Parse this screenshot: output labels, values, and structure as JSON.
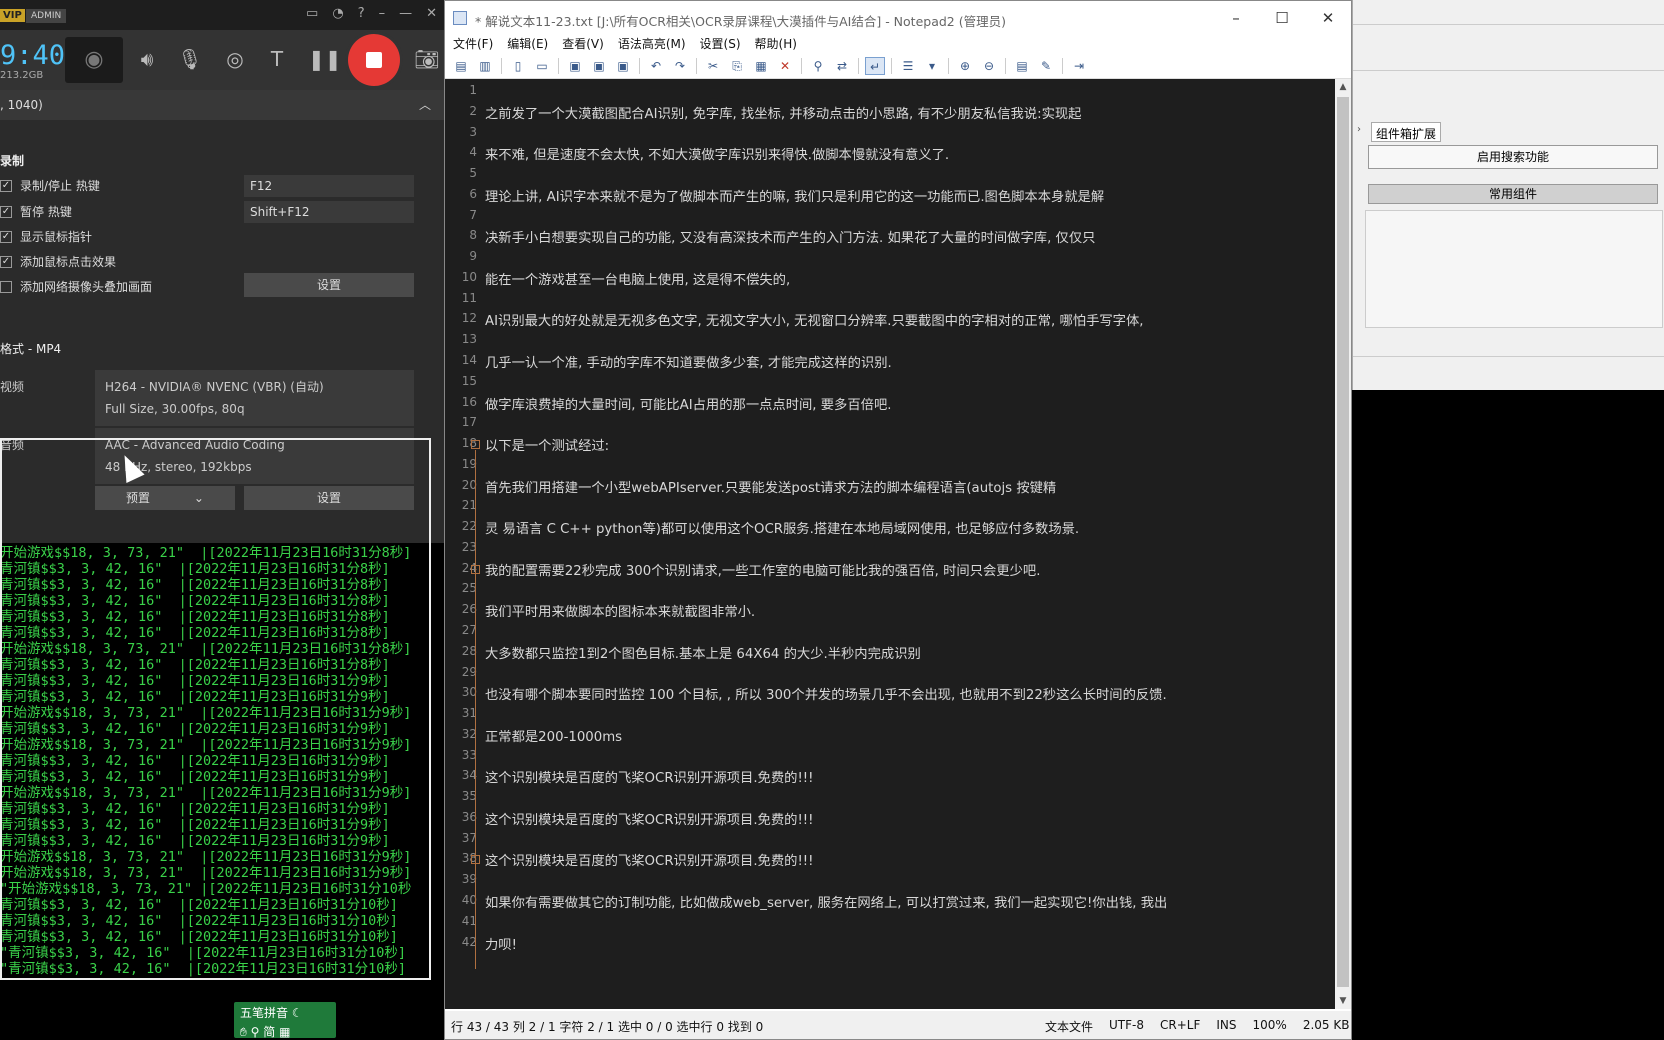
{
  "recorder": {
    "vip": "VIP",
    "admin": "ADMIN",
    "timer": "9:40",
    "storage": "213.2GB",
    "section_header": ", 1040)",
    "record_title": "录制",
    "checkboxes": [
      {
        "label": "录制/停止 热键",
        "checked": true,
        "value": "F12"
      },
      {
        "label": "暂停 热键",
        "checked": true,
        "value": "Shift+F12"
      },
      {
        "label": "显示鼠标指针",
        "checked": true
      },
      {
        "label": "添加鼠标点击效果",
        "checked": true
      },
      {
        "label": "添加网络摄像头叠加画面",
        "checked": false
      }
    ],
    "settings_button": "设置",
    "format_title": "格式 - MP4",
    "video_label": "视频",
    "video_line1": "H264 - NVIDIA® NVENC (VBR) (自动)",
    "video_line2": "Full Size, 30.00fps, 80q",
    "audio_label": "音频",
    "audio_line1": "AAC - Advanced Audio Coding",
    "audio_line2": "48 KHz, stereo, 192kbps",
    "preset_button": "预置",
    "settings_button2": "设置"
  },
  "console_lines": [
    "开始游戏$$18, 3, 73, 21\"  |[2022年11月23日16时31分8秒]",
    "青河镇$$3, 3, 42, 16\"  |[2022年11月23日16时31分8秒]",
    "青河镇$$3, 3, 42, 16\"  |[2022年11月23日16时31分8秒]",
    "青河镇$$3, 3, 42, 16\"  |[2022年11月23日16时31分8秒]",
    "青河镇$$3, 3, 42, 16\"  |[2022年11月23日16时31分8秒]",
    "青河镇$$3, 3, 42, 16\"  |[2022年11月23日16时31分8秒]",
    "开始游戏$$18, 3, 73, 21\"  |[2022年11月23日16时31分8秒]",
    "青河镇$$3, 3, 42, 16\"  |[2022年11月23日16时31分8秒]",
    "青河镇$$3, 3, 42, 16\"  |[2022年11月23日16时31分9秒]",
    "青河镇$$3, 3, 42, 16\"  |[2022年11月23日16时31分9秒]",
    "开始游戏$$18, 3, 73, 21\"  |[2022年11月23日16时31分9秒]",
    "青河镇$$3, 3, 42, 16\"  |[2022年11月23日16时31分9秒]",
    "开始游戏$$18, 3, 73, 21\"  |[2022年11月23日16时31分9秒]",
    "青河镇$$3, 3, 42, 16\"  |[2022年11月23日16时31分9秒]",
    "青河镇$$3, 3, 42, 16\"  |[2022年11月23日16时31分9秒]",
    "开始游戏$$18, 3, 73, 21\"  |[2022年11月23日16时31分9秒]",
    "青河镇$$3, 3, 42, 16\"  |[2022年11月23日16时31分9秒]",
    "青河镇$$3, 3, 42, 16\"  |[2022年11月23日16时31分9秒]",
    "青河镇$$3, 3, 42, 16\"  |[2022年11月23日16时31分9秒]",
    "开始游戏$$18, 3, 73, 21\"  |[2022年11月23日16时31分9秒]",
    "开始游戏$$18, 3, 73, 21\"  |[2022年11月23日16时31分9秒]",
    "\"开始游戏$$18, 3, 73, 21\" |[2022年11月23日16时31分10秒",
    "青河镇$$3, 3, 42, 16\"  |[2022年11月23日16时31分10秒]",
    "青河镇$$3, 3, 42, 16\"  |[2022年11月23日16时31分10秒]",
    "青河镇$$3, 3, 42, 16\"  |[2022年11月23日16时31分10秒]",
    "\"青河镇$$3, 3, 42, 16\"  |[2022年11月23日16时31分10秒]",
    "\"青河镇$$3, 3, 42, 16\"  |[2022年11月23日16时31分10秒]"
  ],
  "ime": {
    "name": "五笔拼音",
    "mode": "简"
  },
  "notepad": {
    "title": "* 解说文本11-23.txt [J:\\所有OCR相关\\OCR录屏课程\\大漠插件与AI结合] - Notepad2 (管理员)",
    "menu": [
      "文件(F)",
      "编辑(E)",
      "查看(V)",
      "语法高亮(M)",
      "设置(S)",
      "帮助(H)"
    ],
    "lines": [
      {
        "n": "1",
        "t": ""
      },
      {
        "n": "2",
        "t": "之前发了一个大漠截图配合AI识别, 免字库, 找坐标, 并移动点击的小思路, 有不少朋友私信我说:实现起"
      },
      {
        "n": "3",
        "t": ""
      },
      {
        "n": "4",
        "t": "来不难, 但是速度不会太快, 不如大漠做字库识别来得快.做脚本慢就没有意义了."
      },
      {
        "n": "5",
        "t": ""
      },
      {
        "n": "6",
        "t": "理论上讲, AI识字本来就不是为了做脚本而产生的嘛, 我们只是利用它的这一功能而已.图色脚本本身就是解"
      },
      {
        "n": "7",
        "t": ""
      },
      {
        "n": "8",
        "t": "决新手小白想要实现自己的功能, 又没有高深技术而产生的入门方法. 如果花了大量的时间做字库, 仅仅只"
      },
      {
        "n": "9",
        "t": ""
      },
      {
        "n": "10",
        "t": "能在一个游戏甚至一台电脑上使用, 这是得不偿失的,"
      },
      {
        "n": "11",
        "t": ""
      },
      {
        "n": "12",
        "t": "AI识别最大的好处就是无视多色文字, 无视文字大小, 无视窗口分辨率.只要截图中的字相对的正常, 哪怕手写字体,"
      },
      {
        "n": "13",
        "t": ""
      },
      {
        "n": "14",
        "t": "几乎一认一个准, 手动的字库不知道要做多少套, 才能完成这样的识别."
      },
      {
        "n": "15",
        "t": ""
      },
      {
        "n": "16",
        "t": "做字库浪费掉的大量时间, 可能比AI占用的那一点点时间, 要多百倍吧."
      },
      {
        "n": "17",
        "t": ""
      },
      {
        "n": "18",
        "t": "以下是一个测试经过:"
      },
      {
        "n": "19",
        "t": ""
      },
      {
        "n": "20",
        "t": "    首先我们用搭建一个小型webAPIserver.只要能发送post请求方法的脚本编程语言(autojs  按键精"
      },
      {
        "n": "21",
        "t": ""
      },
      {
        "n": "22",
        "t": "    灵 易语言 C  C++ python等)都可以使用这个OCR服务.搭建在本地局域网使用, 也足够应付多数场景."
      },
      {
        "n": "23",
        "t": ""
      },
      {
        "n": "24",
        "t": "    我的配置需要22秒完成 300个识别请求,一些工作室的电脑可能比我的强百倍, 时间只会更少吧."
      },
      {
        "n": "25",
        "t": ""
      },
      {
        "n": "26",
        "t": "     我们平时用来做脚本的图标本来就截图非常小."
      },
      {
        "n": "27",
        "t": ""
      },
      {
        "n": "28",
        "t": "    大多数都只监控1到2个图色目标.基本上是  64X64  的大少.半秒内完成识别"
      },
      {
        "n": "29",
        "t": ""
      },
      {
        "n": "30",
        "t": "    也没有哪个脚本要同时监控 100 个目标, , 所以 300个并发的场景几乎不会出现, 也就用不到22秒这么长时间的反馈."
      },
      {
        "n": "31",
        "t": ""
      },
      {
        "n": "32",
        "t": "    正常都是200-1000ms"
      },
      {
        "n": "33",
        "t": ""
      },
      {
        "n": "34",
        "t": "    这个识别模块是百度的飞桨OCR识别开源项目.免费的!!!"
      },
      {
        "n": "35",
        "t": ""
      },
      {
        "n": "36",
        "t": "    这个识别模块是百度的飞桨OCR识别开源项目.免费的!!!"
      },
      {
        "n": "37",
        "t": ""
      },
      {
        "n": "38",
        "t": "    这个识别模块是百度的飞桨OCR识别开源项目.免费的!!!"
      },
      {
        "n": "39",
        "t": ""
      },
      {
        "n": "40",
        "t": "     如果你有需要做其它的订制功能, 比如做成web_server, 服务在网络上, 可以打赏过来, 我们一起实现它!你出钱, 我出"
      },
      {
        "n": "41",
        "t": ""
      },
      {
        "n": "42",
        "t": "     力呗!"
      }
    ],
    "status_left": "行 43 / 43  列 2 / 1  字符 2 / 1  选中 0 / 0  选中行 0  找到 0",
    "status_right": [
      "文本文件",
      "UTF-8",
      "CR+LF",
      "INS",
      "100%",
      "2.05 KB"
    ]
  },
  "rightapp": {
    "tab": "组件箱扩展",
    "btn1": "启用搜索功能",
    "btn2": "常用组件"
  }
}
